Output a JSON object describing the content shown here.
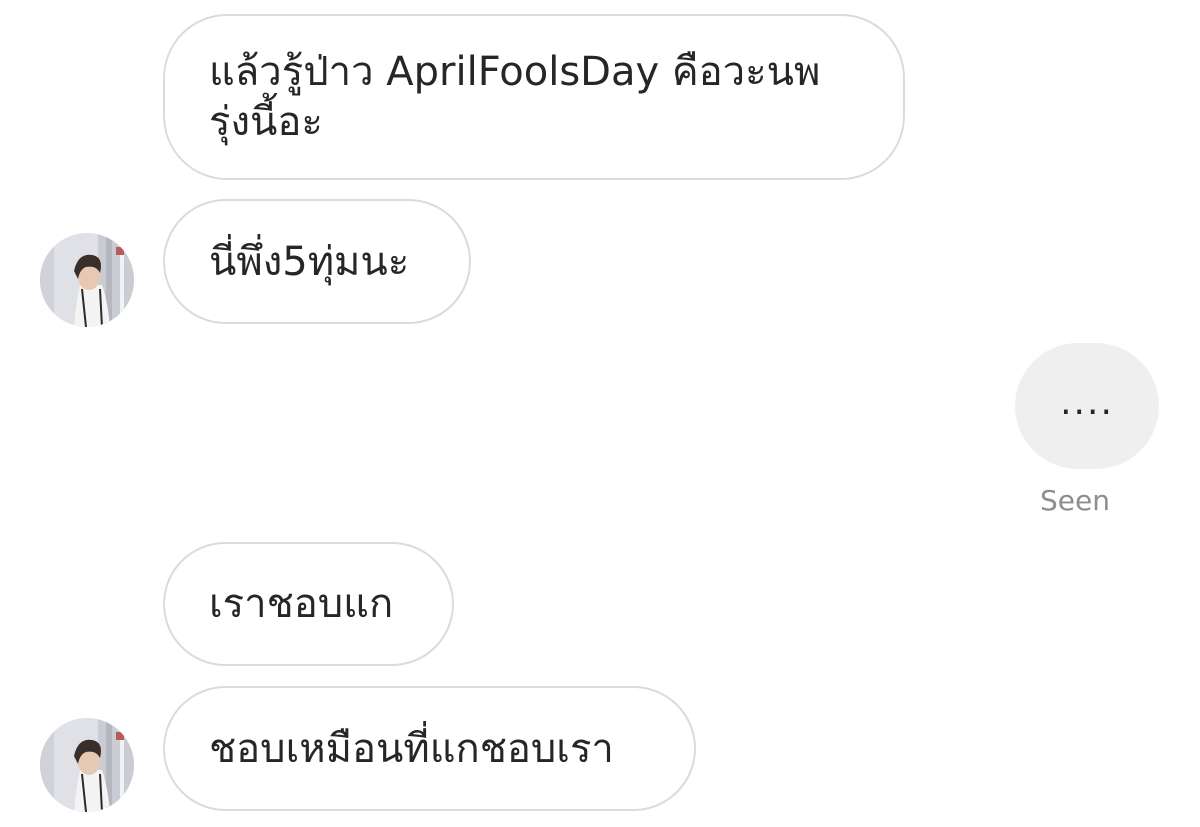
{
  "conversation": {
    "messages": [
      {
        "sender": "other",
        "text": "แล้วรู้ป่าว AprilFoolsDay คือวะนพ\nรุ่งนี้อะ"
      },
      {
        "sender": "other",
        "text": "นี่พึ่ง5ทุ่มนะ"
      },
      {
        "sender": "me",
        "text": "...."
      },
      {
        "sender": "other",
        "text": "เราชอบแก"
      },
      {
        "sender": "other",
        "text": "ชอบเหมือนที่แกชอบเรา"
      }
    ],
    "seen_label": "Seen"
  },
  "avatar": {
    "icon": "profile-photo-icon"
  },
  "colors": {
    "bubble_border": "#dbdbdb",
    "outgoing_bubble_bg": "#efefef",
    "text": "#262626",
    "seen_text": "#8e8e8e"
  }
}
